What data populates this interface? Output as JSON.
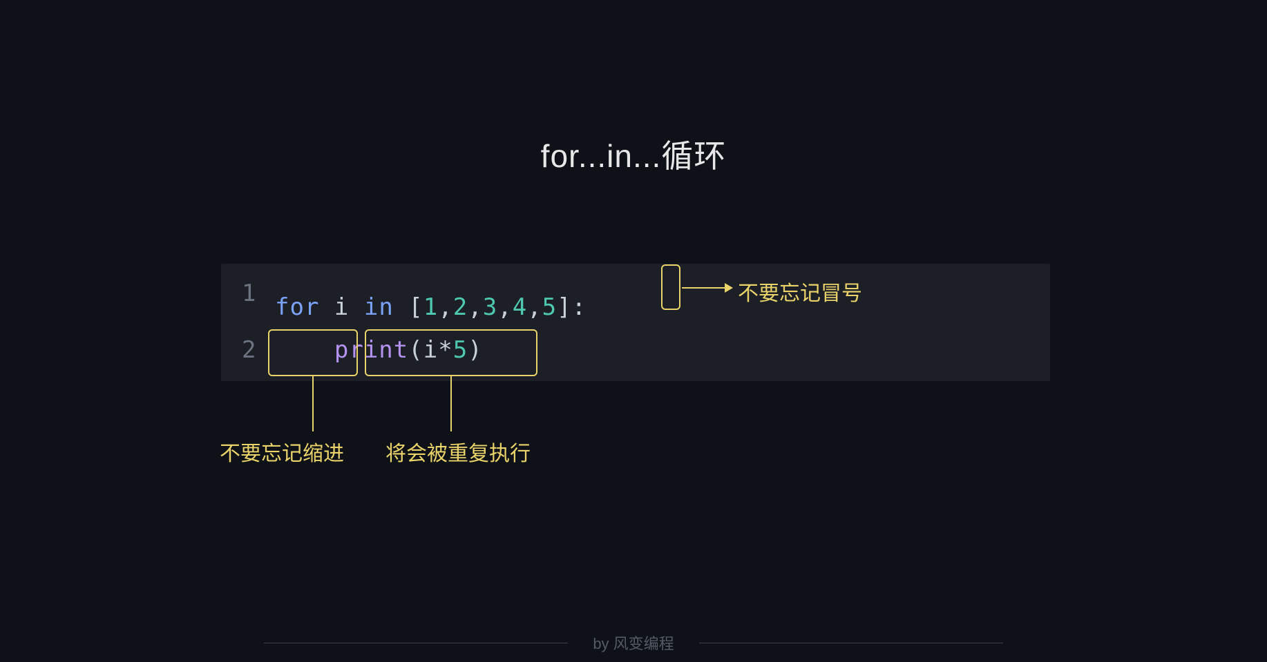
{
  "title": "for...in...循环",
  "code": {
    "line1": {
      "number": "1",
      "for": "for",
      "var": "i",
      "in": "in",
      "lbrack": "[",
      "n1": "1",
      "c1": ",",
      "n2": "2",
      "c2": ",",
      "n3": "3",
      "c3": ",",
      "n4": "4",
      "c4": ",",
      "n5": "5",
      "rbrack": "]",
      "colon": ":"
    },
    "line2": {
      "number": "2",
      "func": "print",
      "lparen": "(",
      "var": "i",
      "star": "*",
      "five": "5",
      "rparen": ")"
    }
  },
  "annotations": {
    "colon": "不要忘记冒号",
    "indent": "不要忘记缩进",
    "print": "将会被重复执行"
  },
  "footer": "by 风变编程"
}
